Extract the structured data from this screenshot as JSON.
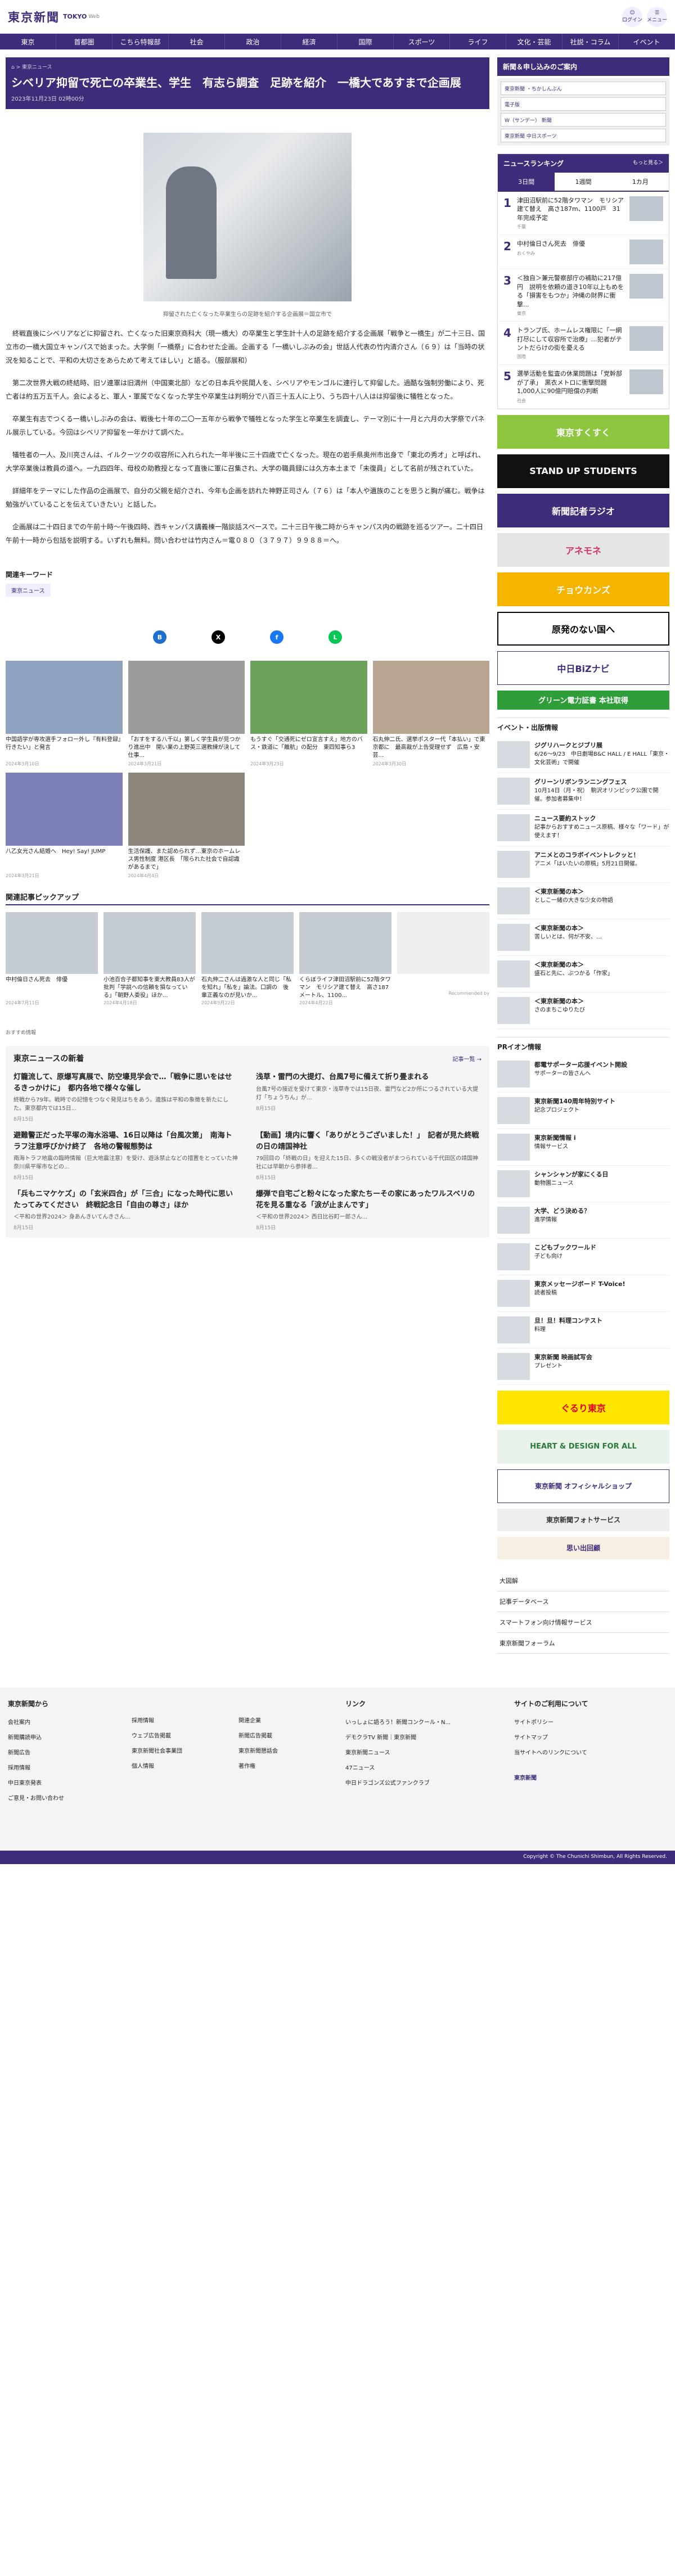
{
  "header": {
    "logo": "東京新聞",
    "logo_sub": "TOKYO",
    "logo_web": "Web",
    "btn_login": "ログイン",
    "btn_menu": "メニュー"
  },
  "nav": [
    "東京",
    "首都圏",
    "こちら特報部",
    "社会",
    "政治",
    "経済",
    "国際",
    "スポーツ",
    "ライフ",
    "文化・芸能",
    "社説・コラム",
    "イベント"
  ],
  "article": {
    "crumb": "⌂ > 東京ニュース",
    "title": "シベリア抑留で死亡の卒業生、学生　有志ら調査　足跡を紹介　一橋大であすまで企画展",
    "date": "2023年11月23日 02時00分",
    "caption": "抑留された亡くなった卒業生らの足跡を紹介する企画展＝国立市で",
    "paragraphs": [
      "終戦直後にシベリアなどに抑留され、亡くなった旧東京商科大（現一橋大）の卒業生と学生計十人の足跡を紹介する企画展「戦争と一橋生」が二十三日、国立市の一橋大国立キャンパスで始まった。大学側「一橋祭」に合わせた企画。企画する「一橋いしぶみの会」世話人代表の竹内清介さん（６９）は「当時の状況を知ることで、平和の大切さをあらためて考えてほしい」と語る。（服部展和）",
      "第二次世界大戦の終結時、旧ソ連軍は旧満州（中国東北部）などの日本兵や民間人を、シベリアやモンゴルに連行して抑留した。過酷な強制労働により、死亡者は約五万五千人。会によると、軍人・軍属でなくなった学生や卒業生は判明分で八百三十五人に上り、うち四十八人はは抑留後に犠牲となった。",
      "卒業生有志でつくる一橋いしぶみの会は、戦後七十年の二〇一五年から戦争で犠牲となった学生と卒業生を調査し、テーマ別に十一月と六月の大学祭でパネル展示している。今回はシベリア抑留を一年かけて調べた。",
      "犠牲者の一人、及川亮さんは、イルクーツクの収容所に入れられた一年半後に三十四歳で亡くなった。現在の岩手県奥州市出身で「東北の秀才」と呼ばれ、大学卒業後は教員の道へ。一九四四年、母校の助教授となって直後に軍に召集され、大学の職員録には久方本土まで「未復員」として名前が残されていた。",
      "詳細年をテーマにした作品の企画展で、自分の父親を紹介され、今年も企画を訪れた神野正司さん（７６）は「本人や遺族のことを思うと胸が痛む。戦争は勉強がいていることを伝えていきたい」と話した。",
      "企画展は二十四日までの午前十時〜午後四時、西キャンパス講義棟一階談話スペースで。二十三日午後二時からキャンパス内の戦跡を巡るツアー。二十四日午前十一時から包括を説明する。いずれも無料。問い合わせは竹内さん＝電０８０（３７９７）９９８８＝へ。"
    ]
  },
  "keywords": {
    "heading": "関連キーワード",
    "tag": "東京ニュース"
  },
  "share": [
    "B",
    "X",
    "f",
    "L"
  ],
  "related": [
    {
      "t": "中国語学が専攻選手フォロー外し『有料登録』行きたい」と発言",
      "d": "2024年3月10日"
    },
    {
      "t": "「おすをする八千以」第しく学生員が見つかり進出中　開い業の上野英三選教練が決して仕事...",
      "d": "2024年3月21日"
    },
    {
      "t": "もうすぐ「交通死にゼロ宣言すえ」地方のバス・鉄道に「離航」の配分　東四知事ら3",
      "d": "2024年3月23日"
    },
    {
      "t": "石丸伸二氏、選挙ポスター代「本払い」で東京都に　最高裁が上告受理せず　広島・安芸...",
      "d": "2024年3月30日"
    },
    {
      "t": "八乙女光さん結婚へ　Hey! Say! JUMP",
      "d": "2024年3月21日"
    },
    {
      "t": "生活保護、また認められず…東京のホームレス男性制度 港区長　「限られた社会で自認識があるまで」",
      "d": "2024年4月4日"
    }
  ],
  "pickup": {
    "heading": "関連記事ピックアップ",
    "items": [
      {
        "t": "中村倫日さん死去　俳優",
        "d": "2024年7月11日"
      },
      {
        "t": "小池百合子都知事を東大教員83人が批判「学説への信頼を損なっている」「朝野人委役」ほか...",
        "d": "2024年4月18日"
      },
      {
        "t": "石丸伸二さんは過激な人と同じ「私を知れ」「私を」論法。口調の　後輩正義なのが見いか...",
        "d": "2024年5月22日"
      },
      {
        "t": "くらぼライフ津田沼駅前に52階タワマン　モリシア建て替え　高さ187メートル、1100...",
        "d": "2024年4月22日"
      },
      {
        "t": "",
        "d": ""
      }
    ],
    "rec": "Recommended by"
  },
  "sm": "おすすめ情報",
  "news": {
    "heading": "東京ニュースの新着",
    "more": "記事一覧 →",
    "items": [
      {
        "t": "灯籠流して、原爆写真展で、防空壕見学会で…「戦争に思いをはせるきっかけに」　都内各地で様々な催し",
        "b": "終戦から79年。戦時での記憶をつなぐ発見はちをあう。遺族は平和の象徴を新たにした。東京都内では15日...",
        "d": "8月15日"
      },
      {
        "t": "浅草・雷門の大提灯、台風7号に備えて折り畳まれる",
        "b": "台風7号の接近を受けて東京・浅草寺では15日夜、雷門など2か所につるされている大提灯「ちょうちん」が...",
        "d": "8月15日"
      },
      {
        "t": "避難警正だった平塚の海水浴場、16日以降は「台風次第」　南海トラフ注意呼びかけ終了　各地の警報態勢は",
        "b": "南海トラフ地震の臨時情報（巨大地震注意）を受け、遊泳禁止などの措置をとっていた神奈川県平塚市などの...",
        "d": "8月15日"
      },
      {
        "t": "【動画】境内に響く「ありがとうございました！」　記者が見た終戦の日の靖国神社",
        "b": "79回目の「終戦の日」を迎えた15日、多くの戦没者がまつられている千代田区の靖国神社には早朝から参拝者...",
        "d": "8月15日"
      },
      {
        "t": "「兵もニマケケズ」の「玄米四合」が「三合」になった時代に思いたってみてください　終戦記念日「自由の尊さ」ほか",
        "b": "＜平和の世界2024＞ 身あんきいてんきさん...",
        "d": "8月15日"
      },
      {
        "t": "爆弾で自宅ごと粉々になった家たちーその家にあったワルスベリの花を見る重なる「涙が止まんです」",
        "b": "＜平和の世界2024＞ 西日比谷町一郎さん...",
        "d": "8月15日"
      }
    ]
  },
  "side": {
    "ad_title": "新聞＆申し込みのご案内",
    "ad_items": [
      "東京新聞 ・ちかしんぶん",
      "電子版",
      "W（サンデー） 新聞",
      "東京新聞 中日スポーツ"
    ],
    "ranking": {
      "heading": "ニュースランキング",
      "more": "もっと見る＞",
      "tabs": [
        "3日間",
        "1週間",
        "1カ月"
      ],
      "items": [
        {
          "t": "津田沼駅前に52階タワマン　モリシア建て替え　高さ187m、1100戸　31年完成予定",
          "c": "千葉"
        },
        {
          "t": "中村倫日さん死去　俳優",
          "c": "おくやみ"
        },
        {
          "t": "＜独自＞兼元警察部庁の補助に217億円　説明を依頼の道き10年以上もめをる「損害をもつか」沖縄の財界に衝撃...",
          "c": "東京"
        },
        {
          "t": "トランプ氏、ホームレス権限に「一網打尽にして収容所で治療」…犯者がテントだらけの街を憂える",
          "c": "国際"
        },
        {
          "t": "選挙活動を監査の休業問題は「党幹部が了承」　黒衣メトロに衝撃問題　1,000人に90億円賠償の判断",
          "c": "社会"
        }
      ]
    },
    "banners": [
      "東京すくすく",
      "STAND UP STUDENTS",
      "新聞記者ラジオ",
      "アネモネ",
      "チョウカンズ",
      "原発のない国へ",
      "中日BiZナビ",
      "グリーン電力証書 本社取得"
    ],
    "events_heading": "イベント・出版情報",
    "events": [
      {
        "b": "ジグリハークとジブリ展",
        "t": "6/26〜9/23　中日劇場B&C HALL / E HALL「東京・文化芸術」で開催"
      },
      {
        "b": "グリーンリボンランニングフェス",
        "t": "10月14日（月・祝）　駒沢オリンピック公園で開催。参加者募集中！"
      },
      {
        "b": "ニュース要約ストック",
        "t": "記事からおすすめニュース原稿、様々な「ワード」が使えます！"
      },
      {
        "b": "アニメとのコラボイベントレクッと！",
        "t": "アニメ「はいたいの原稿」5月21日開催。"
      },
      {
        "b": "＜東京新聞の本＞",
        "t": "としこ一緒の大きな少女の物語"
      },
      {
        "b": "＜東京新聞の本＞",
        "t": "苦しいとは、何が不安、…"
      },
      {
        "b": "＜東京新聞の本＞",
        "t": "盛石と先に、ぶつかる「作家」"
      },
      {
        "b": "＜東京新聞の本＞",
        "t": "さのまちこゆりたび"
      }
    ],
    "pr_heading": "PRイオン情報",
    "pr": [
      {
        "b": "都電サポーター応援イベント開設",
        "t": "サポーターの皆さんへ"
      },
      {
        "b": "東京新聞140周年特別サイト",
        "t": "記念プロジェクト"
      },
      {
        "b": "東京新聞情報 i",
        "t": "情報サービス"
      },
      {
        "b": "シャンシャンが家にくる日",
        "t": "動物園ニュース"
      },
      {
        "b": "大学、どう決める？",
        "t": "進学情報"
      },
      {
        "b": "こどもブックワールド",
        "t": "子ども向け"
      },
      {
        "b": "東京メッセージボード T-Voice!",
        "t": "読者投稿"
      },
      {
        "b": "旦！旦！料理コンテスト",
        "t": "料理"
      },
      {
        "b": "東京新聞 映画試写会",
        "t": "プレゼント"
      }
    ],
    "banners2": [
      "ぐるり東京",
      "HEART & DESIGN FOR ALL",
      "東京新聞 オフィシャルショップ",
      "東京新聞フォトサービス",
      "思い出回顧"
    ],
    "links": [
      "大図解",
      "記事データベース",
      "スマートフォン向け情報サービス",
      "東京新聞フォーラム"
    ]
  },
  "footer": {
    "col1": {
      "h": "東京新聞から",
      "items": [
        "会社案内",
        "新聞購読申込",
        "新聞広告",
        "採用情報",
        "中日東京発表",
        "ご意見・お問い合わせ"
      ]
    },
    "col2": {
      "items": [
        "採用情報",
        "ウェブ広告掲載",
        "東京新聞社会事業団",
        "個人情報"
      ]
    },
    "col3": {
      "items": [
        "関連企業",
        "新聞広告掲載",
        "東京新聞懇話会",
        "著作権"
      ]
    },
    "col4": {
      "h": "リンク",
      "items": [
        "いっしょに語ろう！新聞コンクール・N...",
        "デモクラTV 新聞｜東京新聞",
        "東京新聞ニュース",
        "47ニュース",
        "中日ドラゴンズ公式ファンクラブ"
      ]
    },
    "col5": {
      "h": "サイトのご利用について",
      "items": [
        "サイトポリシー",
        "サイトマップ",
        "当サイトへのリンクについて"
      ],
      "logo": "東京新聞"
    },
    "copyright": "Copyright © The Chunichi Shimbun, All Rights Reserved."
  }
}
